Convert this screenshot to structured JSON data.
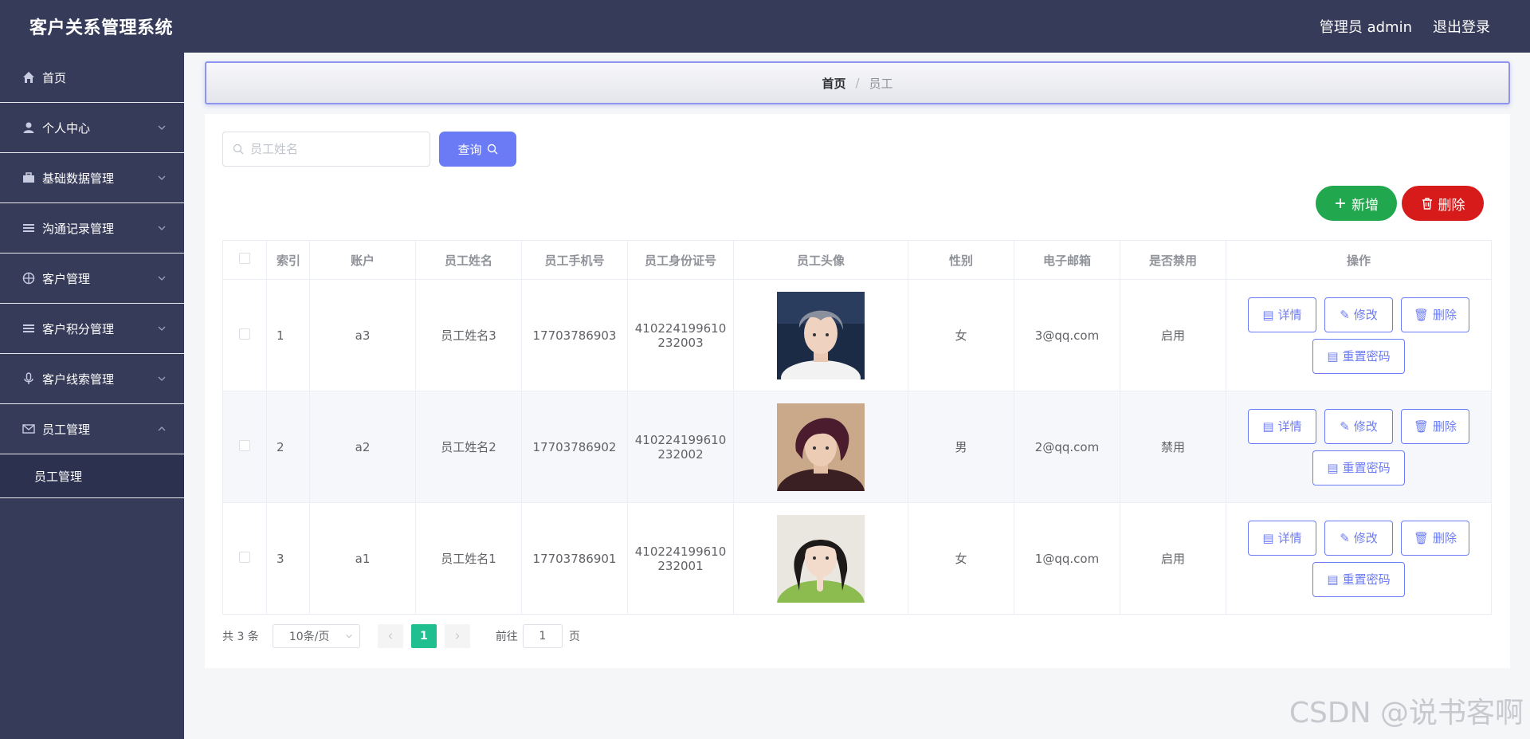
{
  "header": {
    "title": "客户关系管理系统",
    "user_label": "管理员 admin",
    "logout_label": "退出登录"
  },
  "sidebar": {
    "items": [
      {
        "label": "首页",
        "icon": "home-icon"
      },
      {
        "label": "个人中心",
        "icon": "user-icon"
      },
      {
        "label": "基础数据管理",
        "icon": "briefcase-icon"
      },
      {
        "label": "沟通记录管理",
        "icon": "list-icon"
      },
      {
        "label": "客户管理",
        "icon": "crosshair-icon"
      },
      {
        "label": "客户积分管理",
        "icon": "list-icon"
      },
      {
        "label": "客户线索管理",
        "icon": "microphone-icon"
      },
      {
        "label": "员工管理",
        "icon": "mail-icon"
      }
    ],
    "submenu": {
      "label": "员工管理"
    }
  },
  "breadcrumb": {
    "home": "首页",
    "separator": "/",
    "current": "员工"
  },
  "search": {
    "placeholder": "员工姓名",
    "button_label": "查询"
  },
  "actions": {
    "add_label": "新增",
    "delete_label": "删除"
  },
  "table": {
    "headers": [
      "索引",
      "账户",
      "员工姓名",
      "员工手机号",
      "员工身份证号",
      "员工头像",
      "性别",
      "电子邮箱",
      "是否禁用",
      "操作"
    ],
    "rows": [
      {
        "index": "1",
        "account": "a3",
        "name": "员工姓名3",
        "phone": "17703786903",
        "id_line1": "410224199610",
        "id_line2": "232003",
        "gender": "女",
        "email": "3@qq.com",
        "disabled": "启用"
      },
      {
        "index": "2",
        "account": "a2",
        "name": "员工姓名2",
        "phone": "17703786902",
        "id_line1": "410224199610",
        "id_line2": "232002",
        "gender": "男",
        "email": "2@qq.com",
        "disabled": "禁用"
      },
      {
        "index": "3",
        "account": "a1",
        "name": "员工姓名1",
        "phone": "17703786901",
        "id_line1": "410224199610",
        "id_line2": "232001",
        "gender": "女",
        "email": "1@qq.com",
        "disabled": "启用"
      }
    ],
    "op_labels": {
      "detail": "详情",
      "edit": "修改",
      "delete": "删除",
      "reset": "重置密码"
    }
  },
  "pagination": {
    "total": "共 3 条",
    "page_size": "10条/页",
    "current_page": "1",
    "goto_label": "前往",
    "goto_value": "1",
    "page_suffix": "页"
  },
  "watermark": "CSDN @说书客啊",
  "colors": {
    "sidebar": "#363b5a",
    "primary": "#6b7bf5",
    "success": "#21a84e",
    "danger": "#d71b1b",
    "page_active": "#1fbf8f"
  }
}
